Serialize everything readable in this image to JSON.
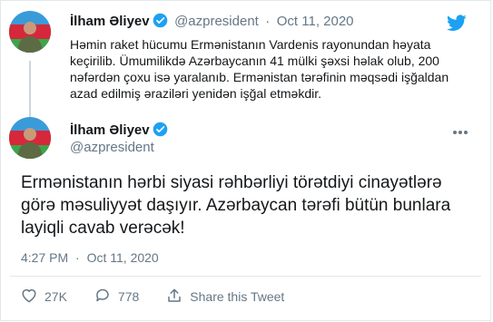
{
  "reply_tweet": {
    "name": "İlham Əliyev",
    "handle": "@azpresident",
    "separator": "·",
    "date": "Oct 11, 2020",
    "text": "Həmin raket hücumu Ermənistanın Vardenis rayonundan həyata\nkeçirilib. Ümumilikdə Azərbaycanın 41 mülki şəxsi həlak olub, 200\nnəfərdən çoxu isə yaralanıb. Ermənistan tərəfinin məqsədi işğaldan\nazad edilmiş əraziləri yenidən işğal etməkdir."
  },
  "main_tweet": {
    "name": "İlham Əliyev",
    "handle": "@azpresident",
    "text": "Ermənistanın hərbi siyasi rəhbərliyi törətdiyi cinayətlərə\ngörə məsuliyyət daşıyır. Azərbaycan tərəfi bütün bunlara\nlayiqli cavab verəcək!",
    "time": "4:27 PM",
    "separator": "·",
    "date": "Oct 11, 2020"
  },
  "actions": {
    "like_count": "27K",
    "reply_count": "778",
    "share_label": "Share this Tweet"
  },
  "icons": {
    "verified": "verified-badge-icon",
    "twitter": "twitter-bird-icon",
    "more": "more-dots-icon",
    "like": "heart-icon",
    "reply": "comment-icon",
    "share": "share-icon"
  },
  "colors": {
    "twitter_blue": "#1da1f2",
    "muted": "#657786",
    "border": "#e1e8ed"
  }
}
